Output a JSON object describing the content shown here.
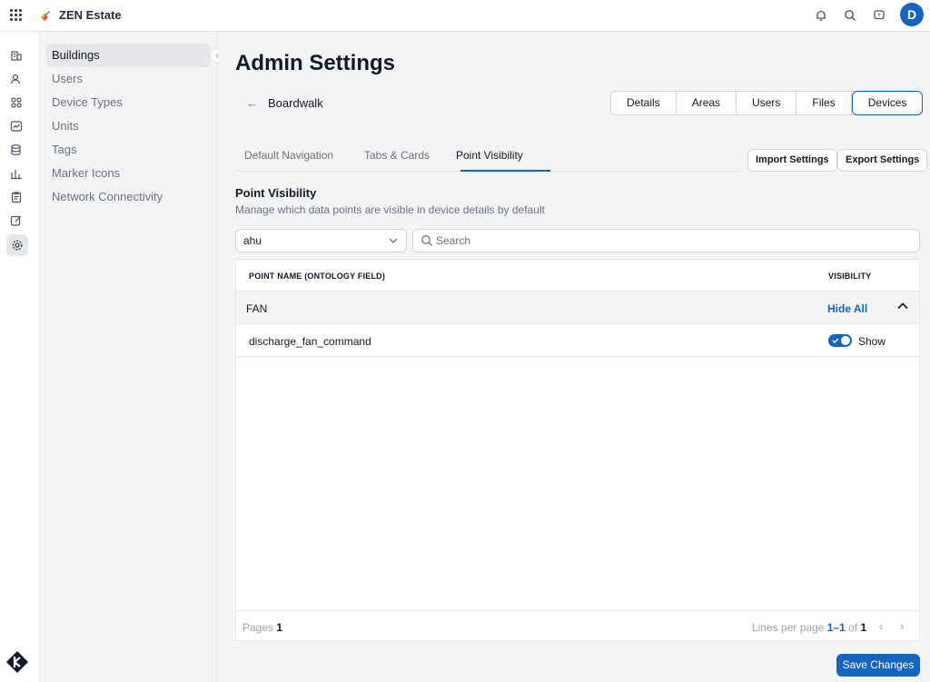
{
  "app": {
    "brand_name": "ZEN Estate",
    "avatar_initial": "D",
    "accent_color": "#1565c0"
  },
  "topbar_icons": [
    "apps-grid-icon",
    "notifications-bell-icon",
    "search-icon",
    "feedback-icon"
  ],
  "rail_icons": [
    "buildings-icon",
    "users-icon",
    "apps-icon",
    "analytics-icon",
    "database-icon",
    "tasks-icon",
    "clipboard-icon",
    "edit-icon",
    "settings-icon"
  ],
  "subnav": {
    "items": [
      {
        "label": "Buildings",
        "active": true
      },
      {
        "label": "Users",
        "active": false
      },
      {
        "label": "Device Types",
        "active": false
      },
      {
        "label": "Units",
        "active": false
      },
      {
        "label": "Tags",
        "active": false
      },
      {
        "label": "Marker Icons",
        "active": false
      },
      {
        "label": "Network Connectivity",
        "active": false
      }
    ]
  },
  "main": {
    "title": "Admin Settings",
    "building": "Boardwalk",
    "segment_tabs": [
      {
        "label": "Details",
        "active": false
      },
      {
        "label": "Areas",
        "active": false
      },
      {
        "label": "Users",
        "active": false
      },
      {
        "label": "Files",
        "active": false
      },
      {
        "label": "Devices",
        "active": true
      }
    ],
    "sub_tabs": [
      {
        "label": "Default Navigation",
        "active": false
      },
      {
        "label": "Tabs & Cards",
        "active": false
      },
      {
        "label": "Point Visibility",
        "active": true
      }
    ],
    "import_label": "Import Settings",
    "export_label": "Export Settings",
    "section_title": "Point Visibility",
    "section_desc": "Manage which data points are visible in device details by default",
    "device_type_value": "ahu",
    "search_placeholder": "Search",
    "table": {
      "col_name": "POINT NAME (ONTOLOGY FIELD)",
      "col_visibility": "VISIBILITY",
      "group": {
        "label": "FAN",
        "action": "Hide All"
      },
      "rows": [
        {
          "point": "discharge_fan_command",
          "visible": true,
          "visibility_label": "Show"
        }
      ]
    },
    "pagination": {
      "pages_label": "Pages",
      "pages_value": "1",
      "lines_label": "Lines per page",
      "range": "1–1",
      "of_label": "of",
      "total": "1"
    },
    "save_label": "Save Changes"
  }
}
